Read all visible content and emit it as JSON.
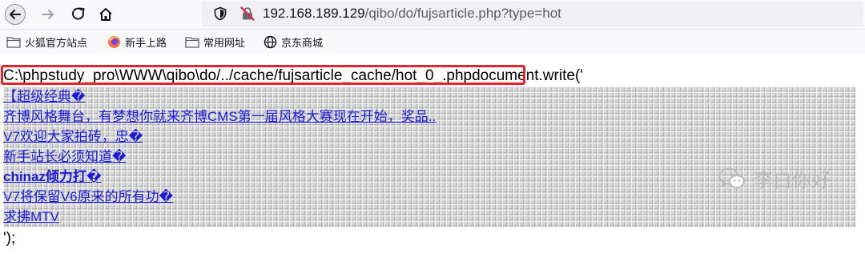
{
  "browser": {
    "url_host": "192.168.189.129",
    "url_path": "/qibo/do/fujsarticle.php?type=hot"
  },
  "bookmarks": [
    {
      "label": "火狐官方站点",
      "icon": "folder-icon"
    },
    {
      "label": "新手上路",
      "icon": "firefox-icon"
    },
    {
      "label": "常用网址",
      "icon": "folder-icon"
    },
    {
      "label": "京东商城",
      "icon": "globe-icon"
    }
  ],
  "page": {
    "cache_path": "C:\\phpstudy_pro\\WWW\\qibo\\do/../cache/fujsarticle_cache/hot_0_.php",
    "doc_write": "document.write('",
    "hot_items": [
      {
        "text": "【超级经典�",
        "bold": false
      },
      {
        "text": "齐博风格舞台，有梦想你就来齐博CMS第一届风格大赛现在开始，奖品..",
        "bold": false
      },
      {
        "text": "V7欢迎大家拍砖，忠�",
        "bold": false
      },
      {
        "text": "新手站长必须知道�",
        "bold": false
      },
      {
        "text": "chinaz倾力打�",
        "bold": true
      },
      {
        "text": "V7将保留V6原来的所有功�",
        "bold": false
      },
      {
        "text": "求拂MTV",
        "bold": false
      }
    ],
    "end_text": "');"
  },
  "watermark": {
    "text": "李白你好",
    "icon": "wechat-icon"
  },
  "colors": {
    "highlight_box": "#e8232d",
    "link": "#1a1ad9",
    "watermark": "#b9b9b9"
  }
}
